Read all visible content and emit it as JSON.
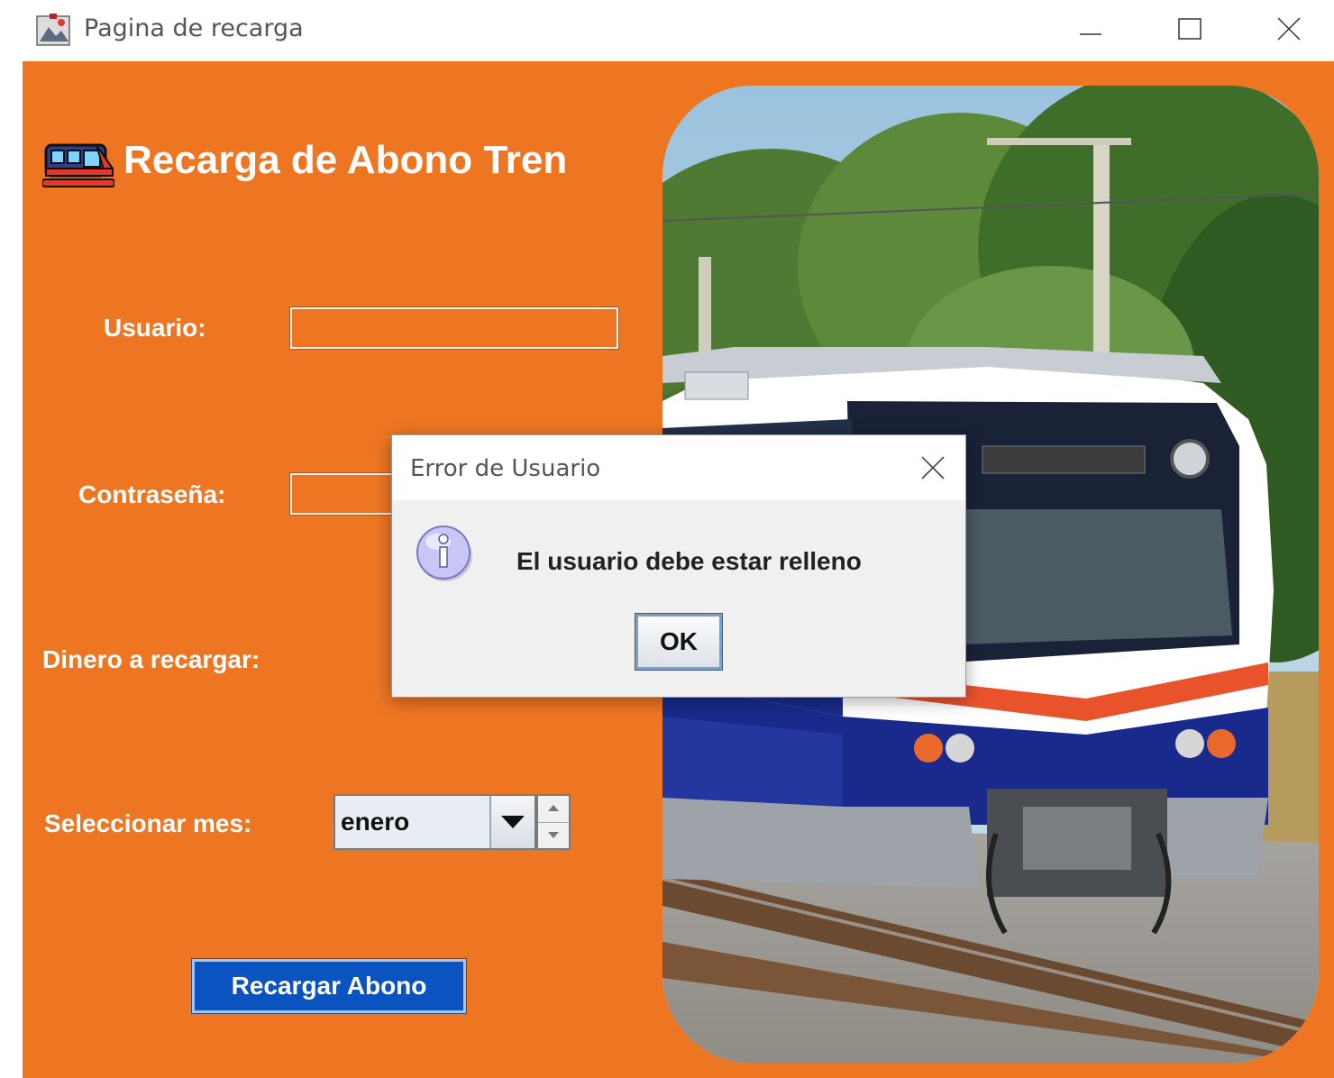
{
  "window": {
    "title": "Pagina de recarga",
    "icons": {
      "app": "app-icon",
      "minimize": "minimize-icon",
      "maximize": "maximize-icon",
      "close": "close-icon"
    }
  },
  "form": {
    "heading": "Recarga de Abono Tren",
    "heading_icon": "train-icon",
    "user_label": "Usuario:",
    "user_value": "",
    "password_label": "Contraseña:",
    "password_value": "",
    "money_label": "Dinero a recargar:",
    "month_label": "Seleccionar mes:",
    "month_selected": "enero",
    "submit_label": "Recargar Abono"
  },
  "dialog": {
    "title": "Error de Usuario",
    "message": "El usuario debe estar relleno",
    "ok_label": "OK",
    "icon": "info-icon"
  },
  "colors": {
    "panel_bg": "#ee7622",
    "submit_bg": "#0a53c1",
    "dialog_bg": "#f0f0f0",
    "info_icon": "#b7b4ef"
  }
}
